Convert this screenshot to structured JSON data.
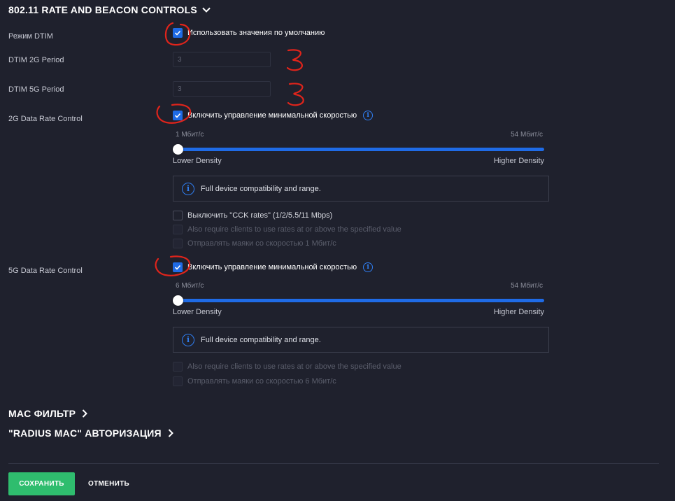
{
  "sections": {
    "rate_beacon_title": "802.11 RATE AND BEACON CONTROLS",
    "mac_filter_title": "MAC ФИЛЬТР",
    "radius_mac_title": "\"RADIUS MAC\" АВТОРИЗАЦИЯ"
  },
  "dtim": {
    "mode_label": "Режим DTIM",
    "use_defaults_label": "Использовать значения по умолчанию",
    "use_defaults_checked": true,
    "period_2g_label": "DTIM 2G Period",
    "period_2g_value": "3",
    "period_5g_label": "DTIM 5G Period",
    "period_5g_value": "3"
  },
  "rate_2g": {
    "label": "2G Data Rate Control",
    "enable_label": "Включить управление минимальной скоростью",
    "enabled": true,
    "min_label": "1 Мбит/с",
    "max_label": "54 Мбит/с",
    "slider_value_fraction": 0.0,
    "lower_label": "Lower Density",
    "higher_label": "Higher Density",
    "info_text": "Full device compatibility and range.",
    "disable_cck_label": "Выключить \"CCK rates\" (1/2/5.5/11 Mbps)",
    "require_clients_label": "Also require clients to use rates at or above the specified value",
    "beacon_label": "Отправлять маяки со скоростью 1 Мбит/с"
  },
  "rate_5g": {
    "label": "5G Data Rate Control",
    "enable_label": "Включить управление минимальной скоростью",
    "enabled": true,
    "min_label": "6 Мбит/с",
    "max_label": "54 Мбит/с",
    "slider_value_fraction": 0.0,
    "lower_label": "Lower Density",
    "higher_label": "Higher Density",
    "info_text": "Full device compatibility and range.",
    "require_clients_label": "Also require clients to use rates at or above the specified value",
    "beacon_label": "Отправлять маяки со скоростью 6 Мбит/с"
  },
  "actions": {
    "save_label": "СОХРАНИТЬ",
    "cancel_label": "ОТМЕНИТЬ"
  },
  "icons": {
    "chevron_down": "chevron-down-icon",
    "chevron_right": "chevron-right-icon",
    "check": "checkmark-icon",
    "info": "info-icon"
  },
  "colors": {
    "background": "#1f212d",
    "accent": "#1f6be6",
    "save_button": "#2fbd6e",
    "annotation": "#e0241b"
  },
  "annotations": {
    "handwritten_2g_value": "3",
    "handwritten_5g_value": "3"
  }
}
